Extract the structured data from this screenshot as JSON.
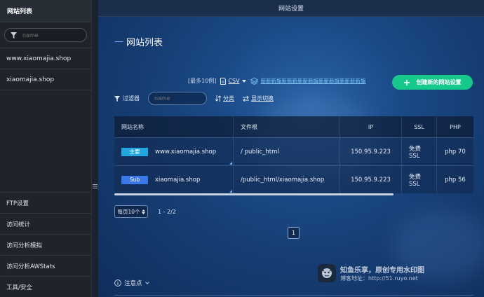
{
  "sidebar": {
    "title": "网站列表",
    "search_placeholder": "name",
    "sites": [
      "www.xiaomajia.shop",
      "xiaomajia.shop"
    ],
    "bottom_items": [
      "FTP设置",
      "访问统计",
      "访问分析模拟",
      "访问分析AWStats",
      "工具/安全"
    ]
  },
  "topbar": {
    "title": "网站设置"
  },
  "page": {
    "title_dash": "—",
    "title": "网站列表"
  },
  "toolbar": {
    "max_note": "[最多10例]",
    "csv_label": "CSV",
    "new_link": "新新新旗新新新新新新旗新新新旗新新新新旗",
    "create_label": "创建新的网站设置",
    "filter_label": "过滤器",
    "filter_placeholder": "name",
    "sort_label": "分类",
    "toggle_label": "显示切换"
  },
  "table": {
    "headers": [
      "网站名称",
      "文件根",
      "IP",
      "SSL",
      "PHP"
    ],
    "rows": [
      {
        "badge": "主要",
        "name": "www.xiaomajia.shop",
        "root": "/ public_html",
        "ip": "150.95.9.223",
        "ssl": "免费SSL",
        "php": "php 70"
      },
      {
        "badge": "Sub",
        "name": "xiaomajia.shop",
        "root": "/public_html/xiaomajia.shop",
        "ip": "150.95.9.223",
        "ssl": "免费SSL",
        "php": "php 56"
      }
    ]
  },
  "pager": {
    "per_page": "每页10个",
    "range": "1 - 2/2",
    "current_page": "1"
  },
  "notes": {
    "label": "注意点"
  },
  "watermark": {
    "line1": "知鱼乐享，原创专用水印图",
    "line2": "博客地址：http://51.ruyo.net"
  },
  "colors": {
    "accent_green": "#16c98a",
    "badge_main": "#22a8e0",
    "badge_sub": "#3a78e8"
  }
}
